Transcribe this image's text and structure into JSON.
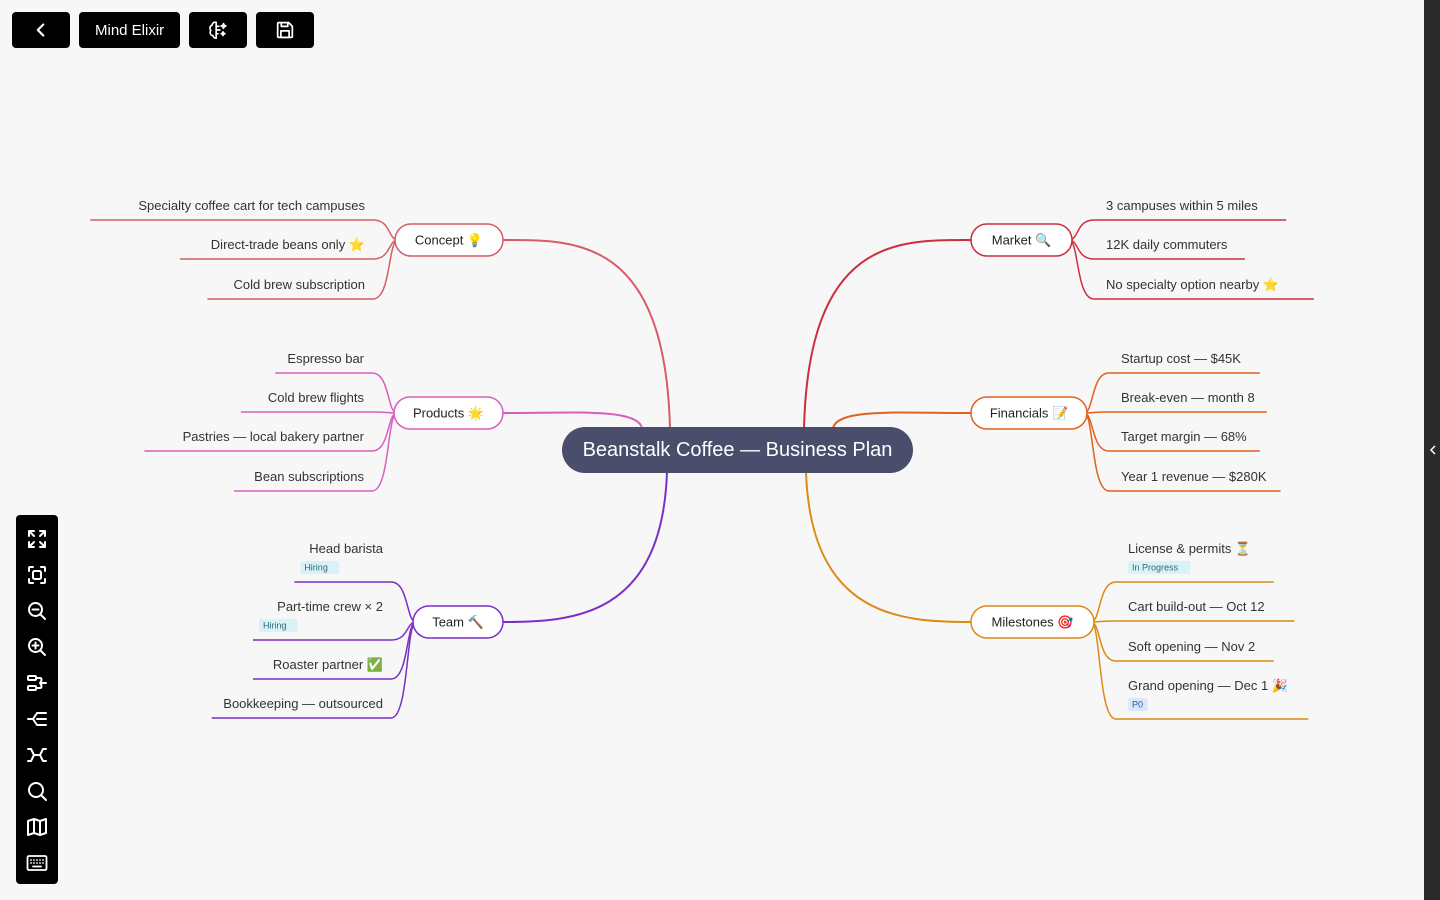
{
  "topbar": {
    "back_icon": "chevron-left-icon",
    "app_title": "Mind Elixir",
    "ai_icon": "brain-sparkle-icon",
    "save_icon": "floppy-disk-icon"
  },
  "right_strip": {
    "icon": "chevron-left-icon"
  },
  "toolbar": {
    "tools": [
      {
        "name": "full-screen",
        "icon": "expand-icon"
      },
      {
        "name": "center",
        "icon": "focus-frame-icon"
      },
      {
        "name": "zoom-out",
        "icon": "zoom-out-icon"
      },
      {
        "name": "zoom-in",
        "icon": "zoom-in-icon"
      },
      {
        "name": "layout-right",
        "icon": "side-layout-icon"
      },
      {
        "name": "layout-left",
        "icon": "left-layout-icon"
      },
      {
        "name": "layout-both",
        "icon": "both-sides-icon"
      },
      {
        "name": "search",
        "icon": "search-icon"
      },
      {
        "name": "minimap",
        "icon": "map-icon"
      },
      {
        "name": "shortcuts",
        "icon": "keyboard-icon"
      }
    ]
  },
  "root": {
    "topic": "Beanstalk Coffee — Business Plan",
    "color": "#4a4d6b"
  },
  "branches": [
    {
      "topic": "Concept",
      "emoji": "💡",
      "color": "#d55d65",
      "children": [
        {
          "text": "Specialty coffee cart for tech campuses"
        },
        {
          "text": "Direct-trade beans only",
          "emoji": "⭐"
        },
        {
          "text": "Cold brew subscription"
        }
      ]
    },
    {
      "topic": "Products",
      "emoji": "🌟",
      "color": "#d85fbf",
      "children": [
        {
          "text": "Espresso bar"
        },
        {
          "text": "Cold brew flights"
        },
        {
          "text": "Pastries — local bakery partner"
        },
        {
          "text": "Bean subscriptions"
        }
      ]
    },
    {
      "topic": "Team",
      "emoji": "🔨",
      "color": "#7c2fc6",
      "children": [
        {
          "text": "Head barista",
          "tag": "Hiring"
        },
        {
          "text": "Part-time crew × 2",
          "tag": "Hiring"
        },
        {
          "text": "Roaster partner",
          "emoji": "✅"
        },
        {
          "text": "Bookkeeping — outsourced"
        }
      ]
    },
    {
      "topic": "Market",
      "emoji": "🔍",
      "color": "#cc2e3e",
      "children": [
        {
          "text": "3 campuses within 5 miles"
        },
        {
          "text": "12K daily commuters"
        },
        {
          "text": "No specialty option nearby",
          "emoji": "⭐"
        }
      ]
    },
    {
      "topic": "Financials",
      "emoji": "📝",
      "color": "#e2611f",
      "children": [
        {
          "text": "Startup cost — $45K"
        },
        {
          "text": "Break-even — month 8"
        },
        {
          "text": "Target margin — 68%"
        },
        {
          "text": "Year 1 revenue — $280K"
        }
      ]
    },
    {
      "topic": "Milestones",
      "emoji": "🎯",
      "color": "#dc8a14",
      "children": [
        {
          "text": "License & permits",
          "emoji": "⏳",
          "tag": "In Progress"
        },
        {
          "text": "Cart build-out — Oct 12"
        },
        {
          "text": "Soft opening — Nov 2"
        },
        {
          "text": "Grand opening — Dec 1",
          "emoji": "🎉",
          "tag": "P0"
        }
      ]
    }
  ]
}
